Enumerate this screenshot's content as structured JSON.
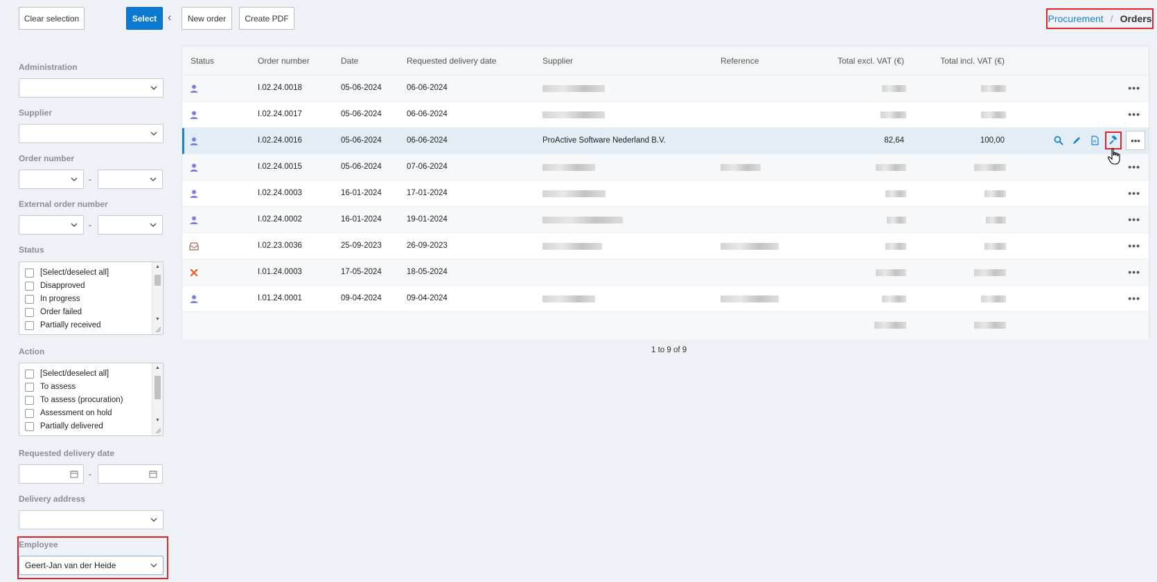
{
  "toolbar": {
    "clear_selection": "Clear selection",
    "select": "Select",
    "new_order": "New order",
    "create_pdf": "Create PDF"
  },
  "breadcrumb": {
    "parent": "Procurement",
    "separator": "/",
    "current": "Orders"
  },
  "filters": {
    "administration": {
      "label": "Administration",
      "value": ""
    },
    "supplier": {
      "label": "Supplier",
      "value": ""
    },
    "order_number": {
      "label": "Order number",
      "from": "",
      "to": "",
      "separator": "-"
    },
    "external_order_number": {
      "label": "External order number",
      "from": "",
      "to": "",
      "separator": "-"
    },
    "status": {
      "label": "Status",
      "options": [
        "[Select/deselect all]",
        "Disapproved",
        "In progress",
        "Order failed",
        "Partially received"
      ]
    },
    "action": {
      "label": "Action",
      "options": [
        "[Select/deselect all]",
        "To assess",
        "To assess (procuration)",
        "Assessment on hold",
        "Partially delivered"
      ]
    },
    "requested_delivery_date": {
      "label": "Requested delivery date",
      "separator": "-"
    },
    "delivery_address": {
      "label": "Delivery address",
      "value": ""
    },
    "employee": {
      "label": "Employee",
      "value": "Geert-Jan van der Heide"
    }
  },
  "table": {
    "columns": {
      "status": "Status",
      "order_number": "Order number",
      "date": "Date",
      "requested_delivery_date": "Requested delivery date",
      "supplier": "Supplier",
      "reference": "Reference",
      "total_excl": "Total excl. VAT (€)",
      "total_incl": "Total incl. VAT (€)"
    },
    "rows": [
      {
        "status_icon": "person-icon",
        "order_number": "I.02.24.0018",
        "date": "05-06-2024",
        "requested": "06-06-2024",
        "supplier": "",
        "reference": "",
        "excl": "",
        "incl": ""
      },
      {
        "status_icon": "person-icon",
        "order_number": "I.02.24.0017",
        "date": "05-06-2024",
        "requested": "06-06-2024",
        "supplier": "",
        "reference": "",
        "excl": "",
        "incl": ""
      },
      {
        "status_icon": "person-icon",
        "order_number": "I.02.24.0016",
        "date": "05-06-2024",
        "requested": "06-06-2024",
        "supplier": "ProActive Software Nederland B.V.",
        "reference": "",
        "excl": "82,64",
        "incl": "100,00"
      },
      {
        "status_icon": "person-icon",
        "order_number": "I.02.24.0015",
        "date": "05-06-2024",
        "requested": "07-06-2024",
        "supplier": "",
        "reference": "",
        "excl": "",
        "incl": ""
      },
      {
        "status_icon": "person-icon",
        "order_number": "I.02.24.0003",
        "date": "16-01-2024",
        "requested": "17-01-2024",
        "supplier": "",
        "reference": "",
        "excl": "",
        "incl": ""
      },
      {
        "status_icon": "person-icon",
        "order_number": "I.02.24.0002",
        "date": "16-01-2024",
        "requested": "19-01-2024",
        "supplier": "",
        "reference": "",
        "excl": "",
        "incl": ""
      },
      {
        "status_icon": "inbox-icon",
        "order_number": "I.02.23.0036",
        "date": "25-09-2023",
        "requested": "26-09-2023",
        "supplier": "",
        "reference": "",
        "excl": "",
        "incl": ""
      },
      {
        "status_icon": "cross-icon",
        "order_number": "I.01.24.0003",
        "date": "17-05-2024",
        "requested": "18-05-2024",
        "supplier": "",
        "reference": "",
        "excl": "",
        "incl": ""
      },
      {
        "status_icon": "person-icon",
        "order_number": "I.01.24.0001",
        "date": "09-04-2024",
        "requested": "09-04-2024",
        "supplier": "",
        "reference": "",
        "excl": "",
        "incl": ""
      }
    ],
    "row_actions": [
      "search-icon",
      "pencil-icon",
      "pdf-icon",
      "hammer-icon",
      "more-icon"
    ]
  },
  "pager": "1 to 9 of 9",
  "colors": {
    "primary": "#0b79d0",
    "link": "#1a85c7",
    "highlight": "#e0232b",
    "status_person": "#7b7fe0",
    "status_inbox": "#b27d6b",
    "status_cross": "#e56a2c"
  }
}
